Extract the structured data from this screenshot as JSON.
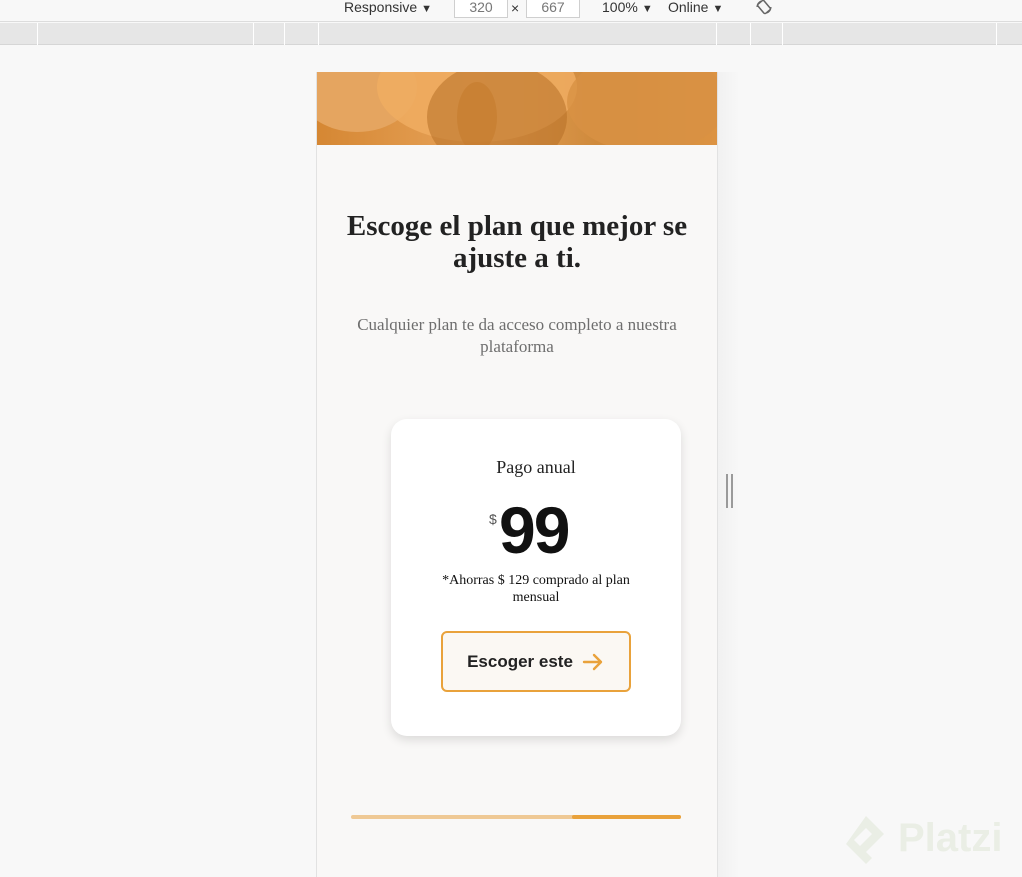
{
  "devtools": {
    "device_label": "Responsive",
    "width_value": "320",
    "height_value": "667",
    "times": "×",
    "zoom_label": "100%",
    "network_label": "Online",
    "caret": "▼",
    "rotate_icon": "rotate-icon"
  },
  "page": {
    "title": "Escoge el plan que mejor se ajuste a ti.",
    "subtitle": "Cualquier plan te da acceso completo a nuestra plataforma",
    "card": {
      "plan_name": "Pago anual",
      "currency": "$",
      "price": "99",
      "savings": "*Ahorras $ 129 comprado al plan mensual",
      "cta_label": "Escoger este",
      "cta_icon": "arrow-right-icon"
    },
    "carousel_progress": 0.33
  },
  "watermark": {
    "text": "Platzi"
  },
  "colors": {
    "accent": "#e9a23b",
    "hero": "#d58733",
    "page_bg": "#f9f8f7"
  }
}
